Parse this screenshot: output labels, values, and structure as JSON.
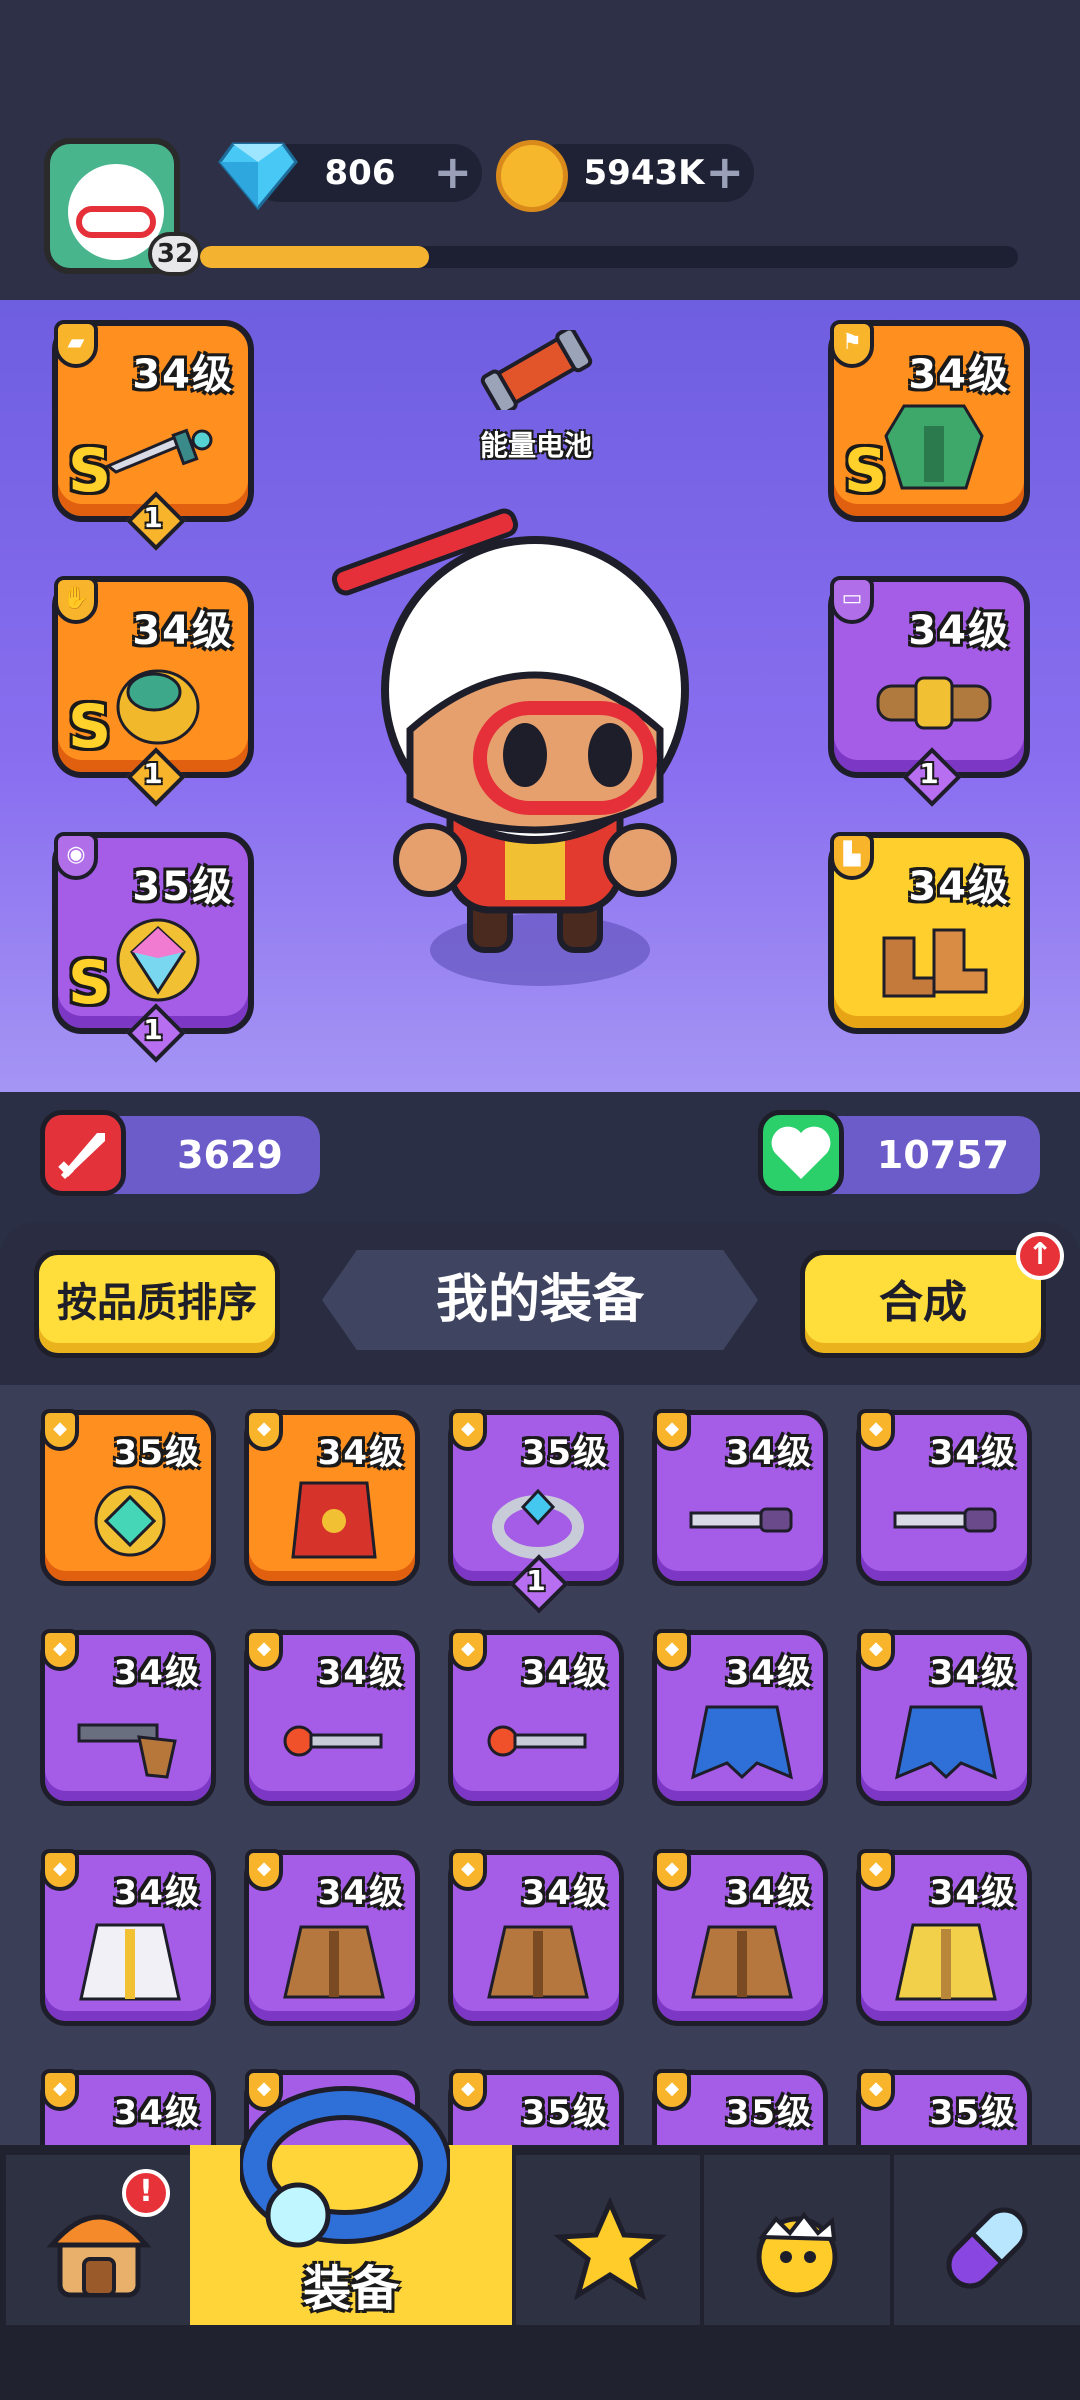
{
  "player": {
    "level": "32",
    "xp_progress": 0.28
  },
  "currency": {
    "gems": "806",
    "coins": "5943K",
    "add_symbol": "+"
  },
  "center": {
    "battery_label": "能量电池"
  },
  "equipped": {
    "left": [
      {
        "level": "34级",
        "rank": "S",
        "stars": "1",
        "rarity": "orange",
        "type_icon": "gun-icon",
        "item": "dagger"
      },
      {
        "level": "34级",
        "rank": "S",
        "stars": "1",
        "rarity": "orange",
        "type_icon": "glove-icon",
        "item": "gauntlet"
      },
      {
        "level": "35级",
        "rank": "S",
        "stars": "1",
        "rarity": "purple",
        "type_icon": "ring-icon",
        "item": "amulet"
      }
    ],
    "right": [
      {
        "level": "34级",
        "rank": "S",
        "rarity": "orange",
        "type_icon": "armor-icon",
        "item": "chest-armor"
      },
      {
        "level": "34级",
        "stars": "1",
        "rarity": "purple",
        "type_icon": "belt-icon",
        "item": "belt"
      },
      {
        "level": "34级",
        "rarity": "gold",
        "type_icon": "boot-icon",
        "item": "boots"
      }
    ]
  },
  "stats": {
    "attack": "3629",
    "health": "10757"
  },
  "inventory": {
    "sort_button": "按品质排序",
    "title": "我的装备",
    "merge_button": "合成",
    "alert_symbol": "↑",
    "items": [
      {
        "level": "35级",
        "rarity": "orange",
        "item": "gem-pendant"
      },
      {
        "level": "34级",
        "rarity": "orange",
        "item": "red-vest"
      },
      {
        "level": "35级",
        "rarity": "purple",
        "item": "ring",
        "stars": "1"
      },
      {
        "level": "34级",
        "rarity": "purple",
        "item": "blade"
      },
      {
        "level": "34级",
        "rarity": "purple",
        "item": "blade"
      },
      {
        "level": "34级",
        "rarity": "purple",
        "item": "revolver"
      },
      {
        "level": "34级",
        "rarity": "purple",
        "item": "wand"
      },
      {
        "level": "34级",
        "rarity": "purple",
        "item": "wand"
      },
      {
        "level": "34级",
        "rarity": "purple",
        "item": "blue-cape"
      },
      {
        "level": "34级",
        "rarity": "purple",
        "item": "blue-cape"
      },
      {
        "level": "34级",
        "rarity": "purple",
        "item": "white-coat"
      },
      {
        "level": "34级",
        "rarity": "purple",
        "item": "brown-jacket"
      },
      {
        "level": "34级",
        "rarity": "purple",
        "item": "brown-jacket"
      },
      {
        "level": "34级",
        "rarity": "purple",
        "item": "brown-jacket"
      },
      {
        "level": "34级",
        "rarity": "purple",
        "item": "gold-coat"
      },
      {
        "level": "34级",
        "rarity": "purple",
        "item": "partial"
      },
      {
        "level": "",
        "rarity": "purple",
        "item": "partial"
      },
      {
        "level": "35级",
        "rarity": "purple",
        "item": "partial"
      },
      {
        "level": "35级",
        "rarity": "purple",
        "item": "partial"
      },
      {
        "level": "35级",
        "rarity": "purple",
        "item": "partial"
      }
    ]
  },
  "nav": {
    "tabs": [
      {
        "name": "shop",
        "label": ""
      },
      {
        "name": "equipment",
        "label": "装备"
      },
      {
        "name": "skills",
        "label": ""
      },
      {
        "name": "pets",
        "label": ""
      },
      {
        "name": "items",
        "label": ""
      }
    ],
    "alert_symbol": "!"
  },
  "colors": {
    "orange": "#ff8f1e",
    "purple": "#a55ce6",
    "gold": "#ffcf2e",
    "yellow": "#ffdd3a"
  }
}
